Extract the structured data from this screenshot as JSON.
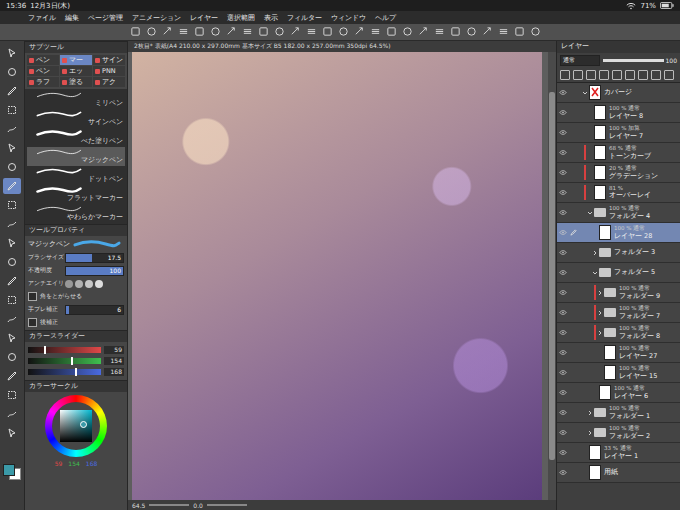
{
  "statusBar": {
    "time": "15:36",
    "date": "12月3日(木)",
    "battery": "71%"
  },
  "menu": [
    "ファイル",
    "編集",
    "ページ管理",
    "アニメーション",
    "レイヤー",
    "選択範囲",
    "表示",
    "フィルター",
    "ウィンドウ",
    "ヘルプ"
  ],
  "tools": [
    {
      "selected": false
    },
    {
      "selected": false
    },
    {
      "selected": false
    },
    {
      "selected": false
    },
    {
      "selected": false
    },
    {
      "selected": false
    },
    {
      "selected": false
    },
    {
      "selected": true
    },
    {
      "selected": false
    },
    {
      "selected": false
    },
    {
      "selected": false
    },
    {
      "selected": false
    },
    {
      "selected": false
    },
    {
      "selected": false
    },
    {
      "selected": false
    },
    {
      "selected": false
    },
    {
      "selected": false
    },
    {
      "selected": false
    },
    {
      "selected": false
    },
    {
      "selected": false
    },
    {
      "selected": false
    }
  ],
  "subTool": {
    "title": "サブツール",
    "tabs": [
      {
        "label": "ペン",
        "selected": false
      },
      {
        "label": "マー",
        "selected": true
      },
      {
        "label": "サイン",
        "selected": false
      },
      {
        "label": "ペン",
        "selected": false
      },
      {
        "label": "エッ",
        "selected": false
      },
      {
        "label": "PNN",
        "selected": false
      },
      {
        "label": "ラフ",
        "selected": false
      },
      {
        "label": "塗る",
        "selected": false
      },
      {
        "label": "アク",
        "selected": false
      }
    ],
    "brushes": [
      {
        "name": "ミリペン",
        "selected": false
      },
      {
        "name": "サインペン",
        "selected": false
      },
      {
        "name": "べた塗りペン",
        "selected": false
      },
      {
        "name": "マジックペン",
        "selected": true
      },
      {
        "name": "ドットペン",
        "selected": false
      },
      {
        "name": "フラットマーカー",
        "selected": false
      },
      {
        "name": "やわらかマーカー",
        "selected": false
      }
    ]
  },
  "toolProperty": {
    "title": "ツールプロパティ",
    "tool": "マジックペン",
    "rows": [
      {
        "kind": "slider",
        "label": "ブラシサイズ",
        "value": "17.5",
        "level": 0.45
      },
      {
        "kind": "slider",
        "label": "不透明度",
        "value": "100",
        "level": 1
      },
      {
        "kind": "icons",
        "label": "アンチエイリ"
      },
      {
        "kind": "check",
        "label": "角をとがらせる",
        "checked": false
      },
      {
        "kind": "slider",
        "label": "手ブレ補正",
        "value": "6",
        "level": 0.06
      },
      {
        "kind": "check",
        "label": "後補正",
        "checked": false
      }
    ]
  },
  "colorSlider": {
    "title": "カラースライダー",
    "channels": [
      {
        "value": "59",
        "level": 0.23,
        "color": "#e04848"
      },
      {
        "value": "154",
        "level": 0.6,
        "color": "#3fbf4f"
      },
      {
        "value": "168",
        "level": 0.66,
        "color": "#4a6ae0"
      }
    ]
  },
  "colorCircle": {
    "title": "カラーサークル"
  },
  "canvas": {
    "title": "2枚目* 表紙(A4 210.00 x 297.00mm 基本サイズ B5 182.00 x 257.00mm 350dpi 64.5%)",
    "zoom": "64.5",
    "angle": "0.0"
  },
  "layers": {
    "title": "レイヤー",
    "blend": "通常",
    "opacity": "100",
    "items": [
      {
        "name": "カバージ",
        "mode": "",
        "kind": "folder",
        "depth": 0,
        "expanded": true,
        "masked": true,
        "clipped": false,
        "selected": false
      },
      {
        "name": "レイヤー 8",
        "mode": "100 % 通常",
        "kind": "layer",
        "depth": 1,
        "expanded": false,
        "masked": false,
        "clipped": false,
        "selected": false
      },
      {
        "name": "レイヤー 7",
        "mode": "100 % 加算",
        "kind": "layer",
        "depth": 1,
        "expanded": false,
        "masked": false,
        "clipped": false,
        "selected": false
      },
      {
        "name": "トーンカーブ",
        "mode": "68 % 通常",
        "kind": "layer",
        "depth": 1,
        "expanded": false,
        "masked": false,
        "clipped": true,
        "selected": false
      },
      {
        "name": "グラデーション",
        "mode": "20 % 通常",
        "kind": "layer",
        "depth": 1,
        "expanded": false,
        "masked": false,
        "clipped": true,
        "selected": false
      },
      {
        "name": "オーバーレイ",
        "mode": "81 %",
        "kind": "layer",
        "depth": 1,
        "expanded": false,
        "masked": false,
        "clipped": true,
        "selected": false
      },
      {
        "name": "フォルダー 4",
        "mode": "100 % 通常",
        "kind": "folder",
        "depth": 1,
        "expanded": true,
        "masked": false,
        "clipped": false,
        "selected": false
      },
      {
        "name": "レイヤー 28",
        "mode": "100 % 通常",
        "kind": "layer",
        "depth": 2,
        "expanded": false,
        "masked": false,
        "clipped": false,
        "selected": true
      },
      {
        "name": "フォルダー 3",
        "mode": "",
        "kind": "folder",
        "depth": 2,
        "expanded": false,
        "masked": false,
        "clipped": false,
        "selected": false
      },
      {
        "name": "フォルダー 5",
        "mode": "",
        "kind": "folder",
        "depth": 2,
        "expanded": true,
        "masked": false,
        "clipped": false,
        "selected": false
      },
      {
        "name": "フォルダー 9",
        "mode": "100 % 通常",
        "kind": "folder",
        "depth": 3,
        "expanded": false,
        "masked": false,
        "clipped": true,
        "selected": false
      },
      {
        "name": "フォルダー 7",
        "mode": "100 % 通常",
        "kind": "folder",
        "depth": 3,
        "expanded": false,
        "masked": false,
        "clipped": true,
        "selected": false
      },
      {
        "name": "フォルダー 8",
        "mode": "100 % 通常",
        "kind": "folder",
        "depth": 3,
        "expanded": false,
        "masked": false,
        "clipped": true,
        "selected": false
      },
      {
        "name": "レイヤー 27",
        "mode": "100 % 通常",
        "kind": "layer",
        "depth": 3,
        "expanded": false,
        "masked": false,
        "clipped": false,
        "selected": false
      },
      {
        "name": "レイヤー 15",
        "mode": "100 % 通常",
        "kind": "layer",
        "depth": 3,
        "expanded": false,
        "masked": false,
        "clipped": false,
        "selected": false
      },
      {
        "name": "レイヤー 6",
        "mode": "100 % 通常",
        "kind": "layer",
        "depth": 2,
        "expanded": false,
        "masked": false,
        "clipped": false,
        "selected": false
      },
      {
        "name": "フォルダー 1",
        "mode": "100 % 通常",
        "kind": "folder",
        "depth": 1,
        "expanded": false,
        "masked": false,
        "clipped": false,
        "selected": false
      },
      {
        "name": "フォルダー 2",
        "mode": "100 % 通常",
        "kind": "folder",
        "depth": 1,
        "expanded": false,
        "masked": false,
        "clipped": false,
        "selected": false
      },
      {
        "name": "レイヤー 1",
        "mode": "33 % 通常",
        "kind": "layer",
        "depth": 0,
        "expanded": false,
        "masked": false,
        "clipped": false,
        "selected": false
      },
      {
        "name": "用紙",
        "mode": "",
        "kind": "layer",
        "depth": 0,
        "expanded": false,
        "masked": false,
        "clipped": false,
        "selected": false
      }
    ]
  }
}
